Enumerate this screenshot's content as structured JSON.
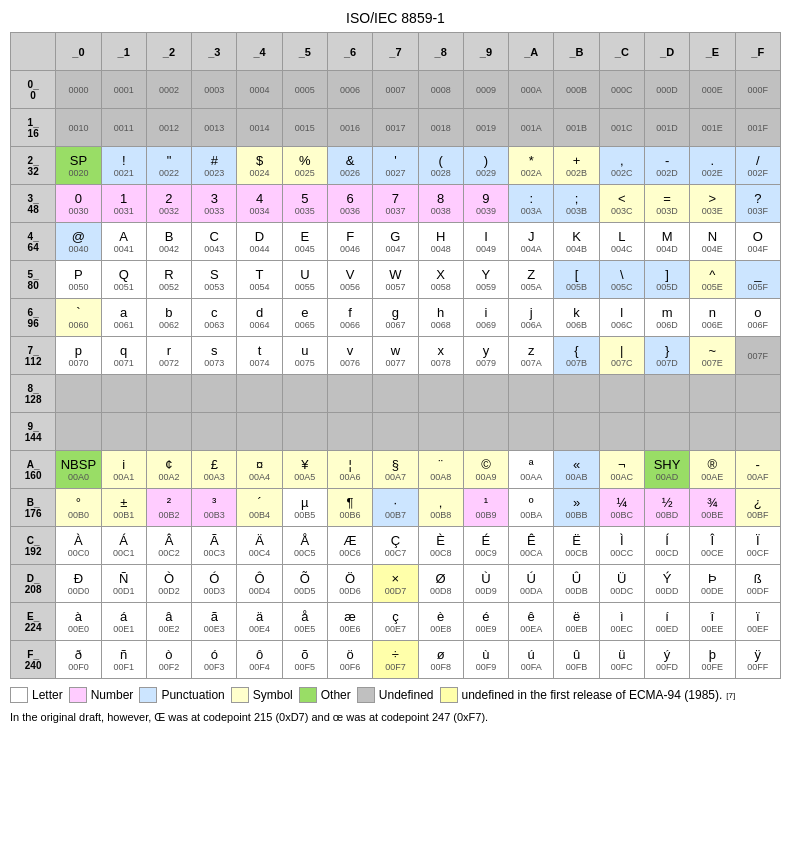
{
  "title": "ISO/IEC 8859-1",
  "col_headers": [
    "_0",
    "_1",
    "_2",
    "_3",
    "_4",
    "_5",
    "_6",
    "_7",
    "_8",
    "_9",
    "_A",
    "_B",
    "_C",
    "_D",
    "_E",
    "_F"
  ],
  "row_headers": [
    {
      "label": "0_\n0",
      "range": "0"
    },
    {
      "label": "1_\n16",
      "range": "16"
    },
    {
      "label": "2_\n32",
      "range": "32"
    },
    {
      "label": "3_\n48",
      "range": "48"
    },
    {
      "label": "4_\n64",
      "range": "64"
    },
    {
      "label": "5_\n80",
      "range": "80"
    },
    {
      "label": "6_\n96",
      "range": "96"
    },
    {
      "label": "7_\n112",
      "range": "112"
    },
    {
      "label": "8_\n128",
      "range": "128"
    },
    {
      "label": "9_\n144",
      "range": "144"
    },
    {
      "label": "A_\n160",
      "range": "160"
    },
    {
      "label": "B_\n176",
      "range": "176"
    },
    {
      "label": "C_\n192",
      "range": "192"
    },
    {
      "label": "D_\n208",
      "range": "208"
    },
    {
      "label": "E_\n224",
      "range": "224"
    },
    {
      "label": "F_\n240",
      "range": "240"
    }
  ],
  "legend": {
    "letter_label": "Letter",
    "number_label": "Number",
    "punctuation_label": "Punctuation",
    "symbol_label": "Symbol",
    "other_label": "Other",
    "undefined_label": "Undefined",
    "ecma_label": "undefined in the first release of ECMA-94 (1985)."
  },
  "footnote": "In the original draft, however, Œ was at codepoint 215 (0xD7) and œ was at codepoint 247 (0xF7)."
}
